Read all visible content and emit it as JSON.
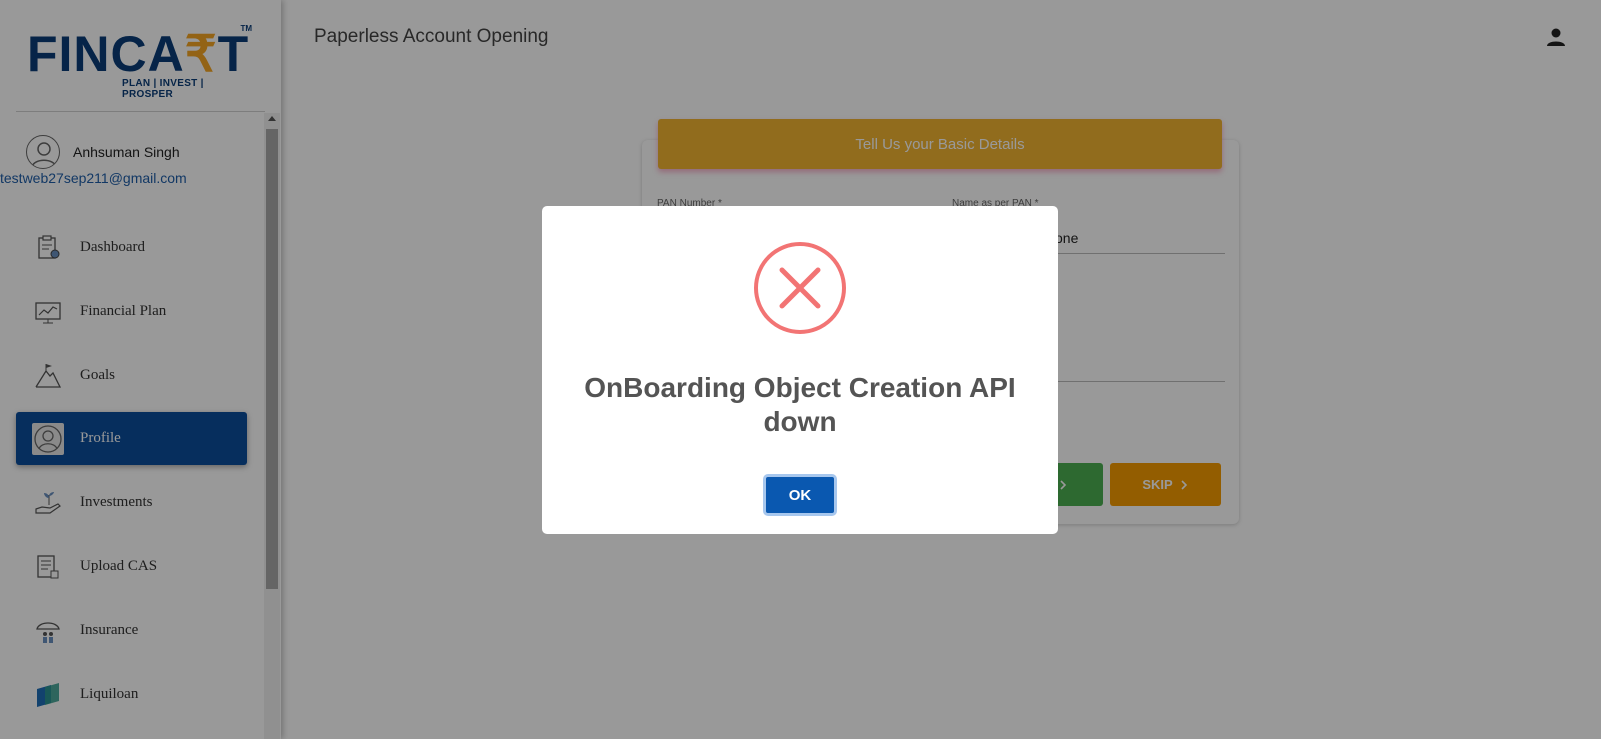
{
  "logo": {
    "text_main": "FINCA",
    "text_accent": "₹",
    "text_end": "T",
    "tm": "TM",
    "tagline": "PLAN | INVEST | PROSPER"
  },
  "user": {
    "name": "Anhsuman Singh",
    "email": "testweb27sep211@gmail.com"
  },
  "sidebar": {
    "items": [
      {
        "label": "Dashboard",
        "icon": "dashboard-icon",
        "active": false
      },
      {
        "label": "Financial Plan",
        "icon": "chart-icon",
        "active": false
      },
      {
        "label": "Goals",
        "icon": "mountain-flag-icon",
        "active": false
      },
      {
        "label": "Profile",
        "icon": "user-icon",
        "active": true
      },
      {
        "label": "Investments",
        "icon": "hand-plant-icon",
        "active": false
      },
      {
        "label": "Upload CAS",
        "icon": "document-icon",
        "active": false
      },
      {
        "label": "Insurance",
        "icon": "umbrella-family-icon",
        "active": false
      },
      {
        "label": "Liquiloan",
        "icon": "liquiloan-icon",
        "active": false
      }
    ]
  },
  "header": {
    "title": "Paperless Account Opening"
  },
  "form": {
    "header": "Tell Us your Basic Details",
    "pan_label": "PAN Number *",
    "name_label": "Name as per PAN *",
    "name_value_fragment": "one",
    "skip_label": "SKIP"
  },
  "modal": {
    "title": "OnBoarding Object Creation API down",
    "ok_label": "OK"
  },
  "colors": {
    "primary": "#0a4d9c",
    "header_yellow": "#f2b531",
    "error_red": "#f27474",
    "skip_orange": "#f59c00",
    "green": "#4caf50"
  }
}
